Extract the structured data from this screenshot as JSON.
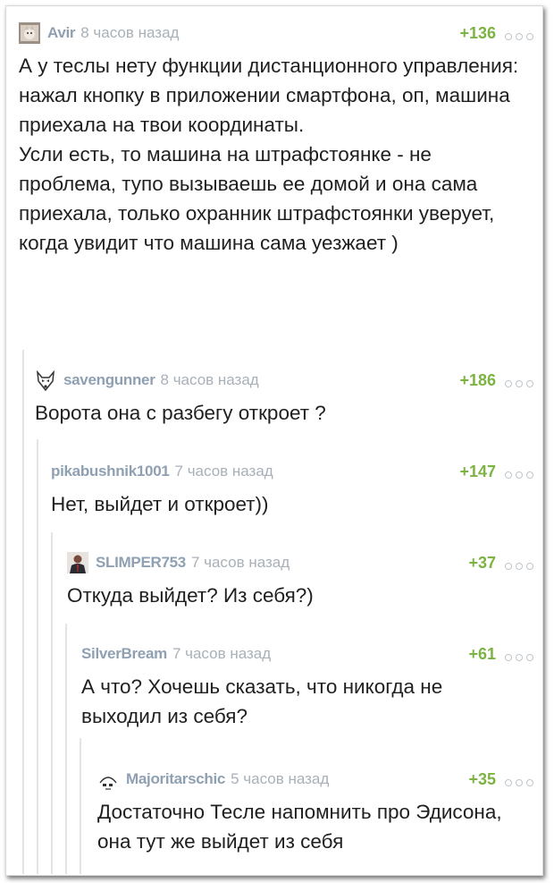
{
  "comments": [
    {
      "author": "Avir",
      "time": "8 часов назад",
      "rating": "+136",
      "avatar_icon": "cat-photo-avatar",
      "text": "А у теслы нету функции дистанционного управления: нажал кнопку в приложении смартфона, оп, машина приехала на твои координаты.\nУсли есть, то машина на штрафстоянке - не проблема, тупо вызываешь ее домой и она сама приехала, только охранник штрафстоянки уверует, когда увидит что машина сама уезжает )"
    },
    {
      "author": "savengunner",
      "time": "8 часов назад",
      "rating": "+186",
      "avatar_icon": "wolf-avatar",
      "text": "Ворота она с разбегу откроет ?"
    },
    {
      "author": "pikabushnik1001",
      "time": "7 часов назад",
      "rating": "+147",
      "avatar_icon": "",
      "text": "Нет, выйдет и откроет))"
    },
    {
      "author": "SLIMPER753",
      "time": "7 часов назад",
      "rating": "+37",
      "avatar_icon": "suit-man-avatar",
      "text": "Откуда выйдет? Из себя?)"
    },
    {
      "author": "SilverBream",
      "time": "7 часов назад",
      "rating": "+61",
      "avatar_icon": "",
      "text": "А что? Хочешь сказать, что никогда не выходил из себя?"
    },
    {
      "author": "Majoritarschic",
      "time": "5 часов назад",
      "rating": "+35",
      "avatar_icon": "face-sketch-avatar",
      "text": "Достаточно Тесле напомнить про Эдисона, она тут же выйдет из себя"
    }
  ],
  "colors": {
    "author": "#8fa0b3",
    "time": "#a8b0b8",
    "rating": "#7cb342",
    "text": "#1f1f1f",
    "thread_line": "#e2e5e8"
  }
}
